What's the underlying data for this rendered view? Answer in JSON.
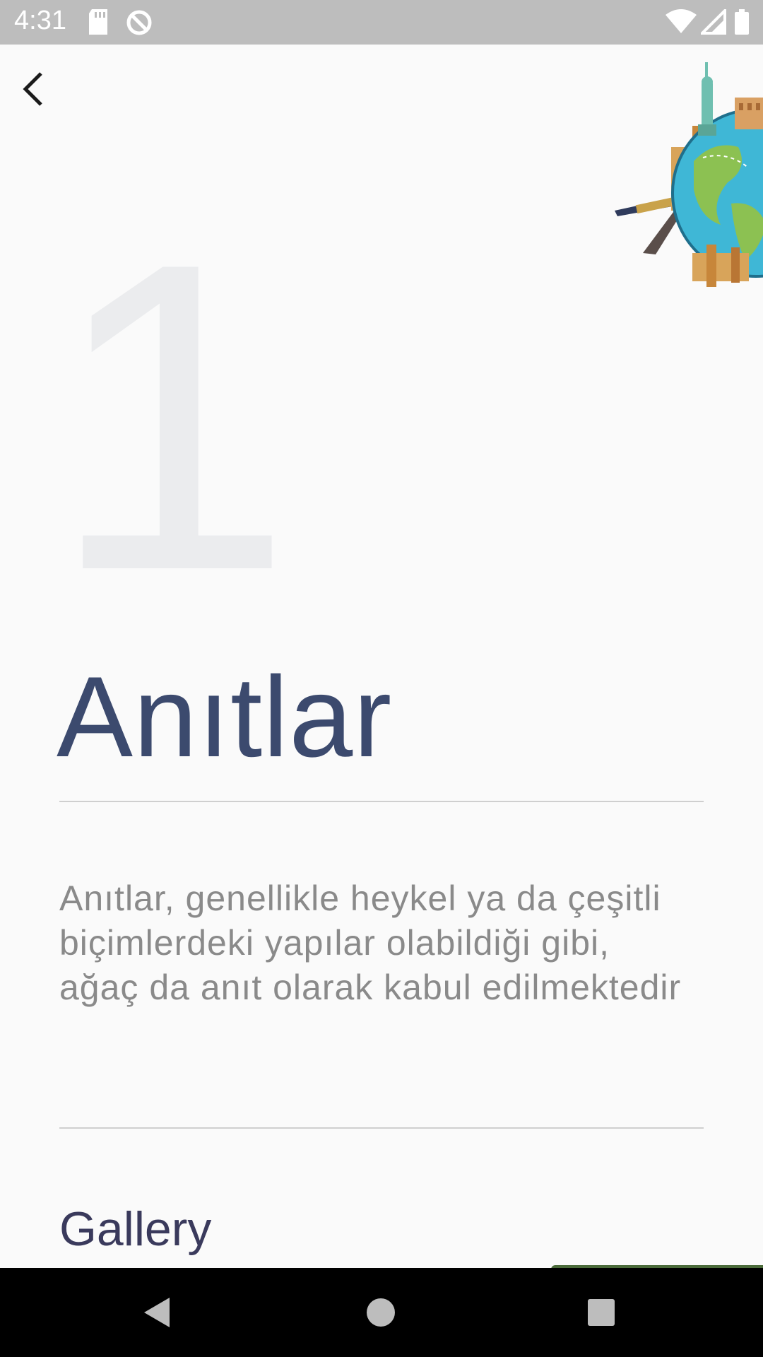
{
  "status_bar": {
    "time": "4:31",
    "icons": [
      "sd-card-icon",
      "do-not-disturb-icon",
      "wifi-icon",
      "signal-icon",
      "battery-icon"
    ]
  },
  "header": {
    "back_icon": "chevron-left-icon",
    "illustration": "world-landmarks-globe-illustration"
  },
  "content": {
    "number": "1",
    "title": "Anıtlar",
    "description": "Anıtlar, genellikle heykel ya da çeşitli biçimlerdeki yapılar olabildiği gibi, ağaç da anıt olarak kabul edilmektedir",
    "gallery_heading": "Gallery"
  },
  "nav_bar": {
    "icons": [
      "back-triangle-icon",
      "home-circle-icon",
      "recents-square-icon"
    ]
  },
  "colors": {
    "title": "#3c4a6e",
    "number": "#ebecee",
    "description": "#8a8a8a",
    "background": "#fafafa"
  }
}
